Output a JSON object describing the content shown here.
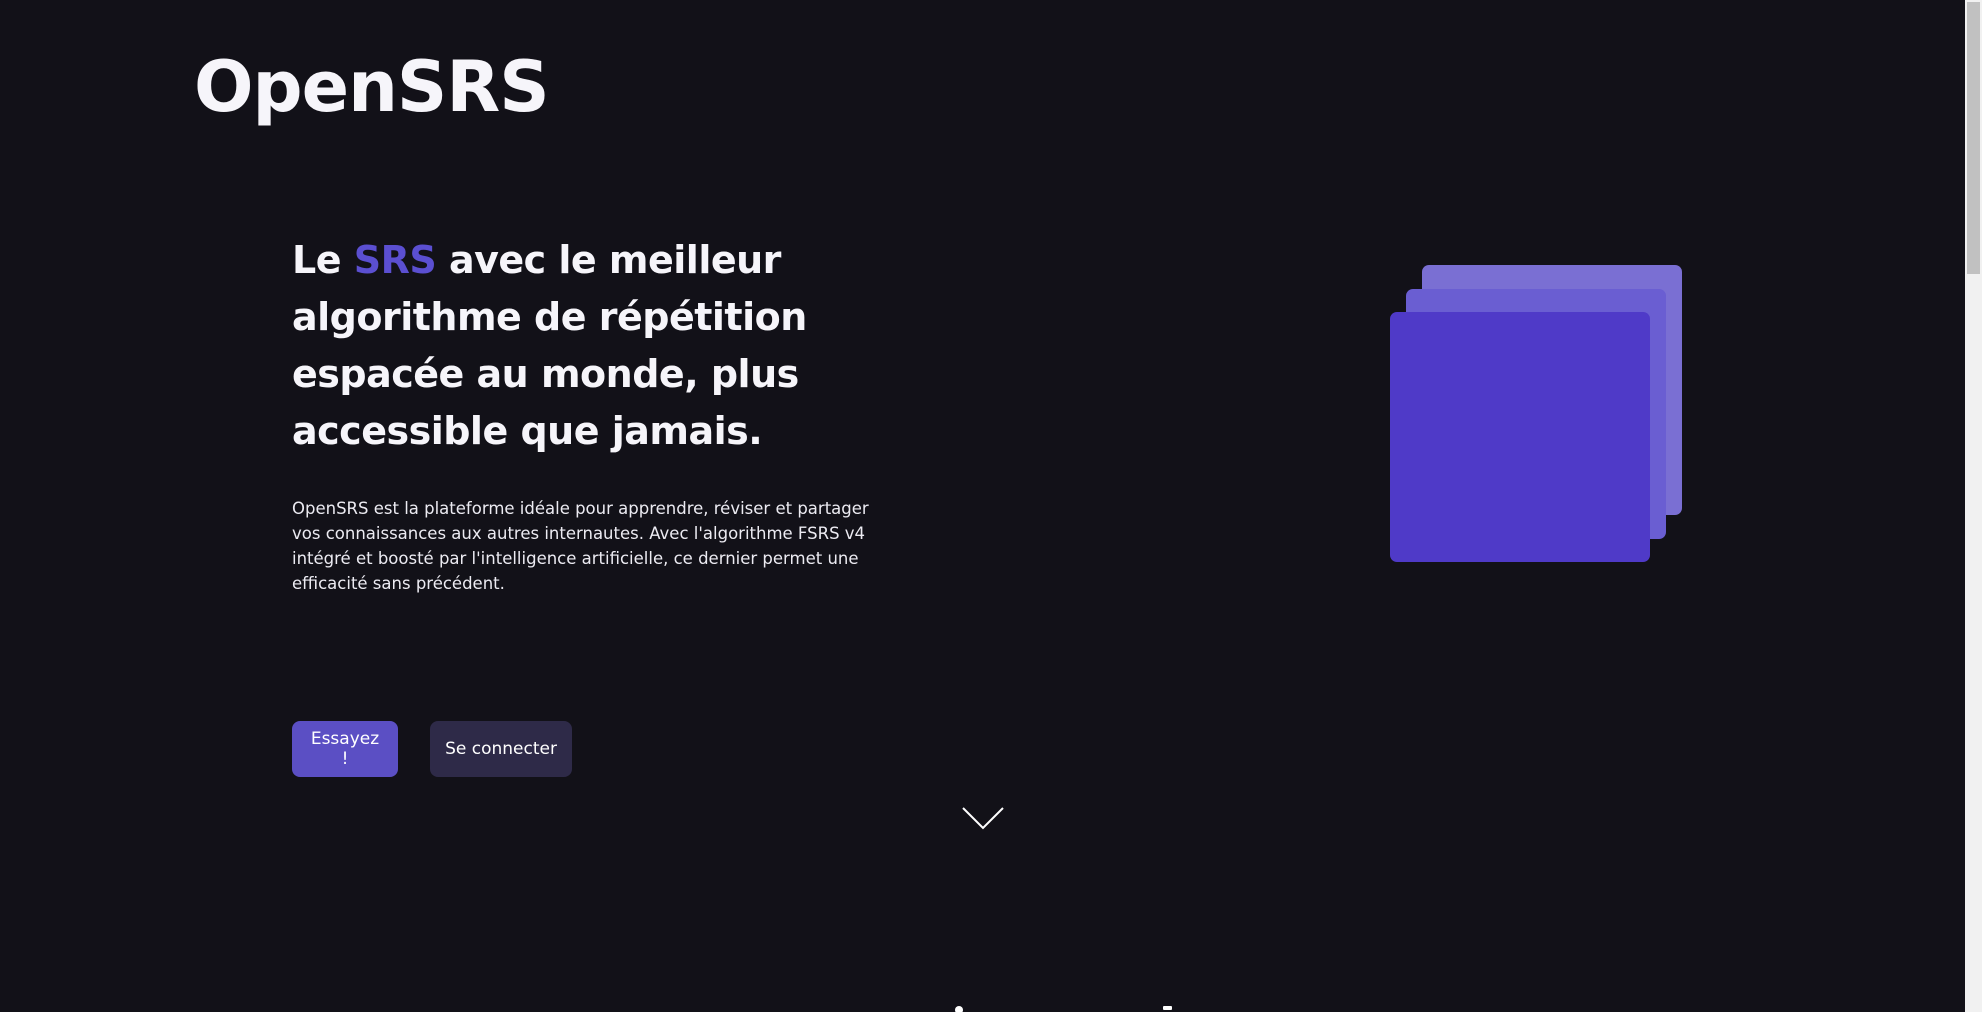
{
  "brand": {
    "name": "OpenSRS"
  },
  "hero": {
    "title_before": "Le ",
    "title_accent": "SRS",
    "title_after": " avec le meilleur algorithme de répétition espacée au monde, plus accessible que jamais.",
    "description": "OpenSRS est la plateforme idéale pour apprendre, réviser et partager vos connaissances aux autres internautes. Avec l'algorithme FSRS v4 intégré et boosté par l'intelligence artificielle, ce dernier permet une efficacité sans précédent."
  },
  "actions": {
    "try_label": "Essayez !",
    "login_label": "Se connecter"
  },
  "icons": {
    "scroll_down": "chevron-down-icon"
  },
  "colors": {
    "background": "#121118",
    "accent": "#5b4fd1",
    "primary_button": "#5b4fc4",
    "secondary_button": "#2e2a48",
    "card_front": "#4f3ac8",
    "card_mid": "#6a5ed2",
    "card_back": "#7a6fd3"
  }
}
